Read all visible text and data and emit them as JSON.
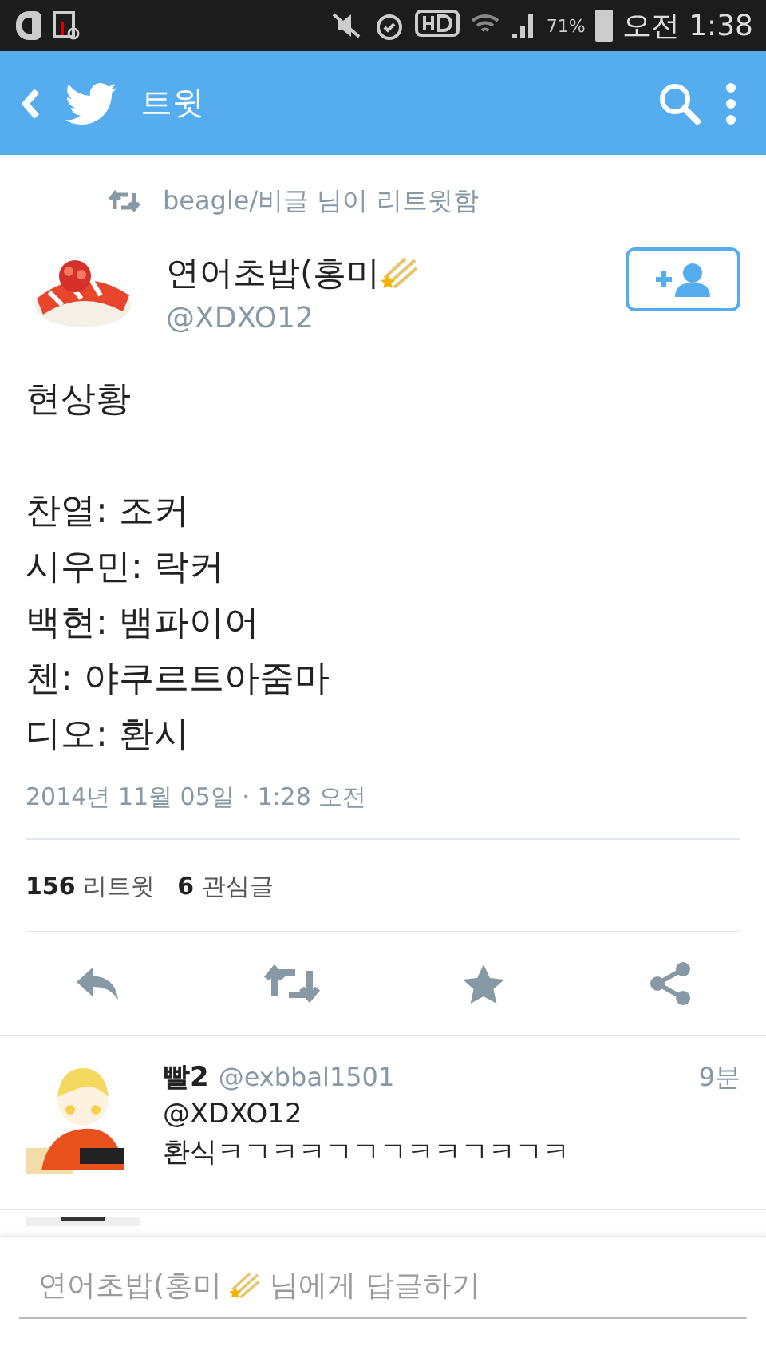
{
  "status_bar": {
    "battery": "71%",
    "time": "오전 1:38"
  },
  "app_bar": {
    "title": "트윗"
  },
  "retweeted_by": "beagle/비글 님이 리트윗함",
  "tweet": {
    "author_name": "연어초밥(홍미",
    "handle": "@XDXO12",
    "text": "현상황\n\n찬열: 조커\n시우민: 락커\n백현: 뱀파이어\n첸: 야쿠르트아줌마\n디오: 환시",
    "timestamp": "2014년 11월 05일 · 1:28 오전",
    "stats": [
      {
        "count": "156",
        "label": "리트윗"
      },
      {
        "count": "6",
        "label": "관심글"
      }
    ]
  },
  "replies": [
    {
      "name": "빨2",
      "handle": "@exbbal1501",
      "time": "9분",
      "lines": [
        "@XDXO12",
        "환식ㅋㄱㅋㅋㄱㄱㄱㅋㅋㄱㅋㄱㅋ"
      ]
    }
  ],
  "reply_bar": {
    "placeholder_before": "연어초밥(홍미",
    "placeholder_after": "님에게 답글하기"
  }
}
